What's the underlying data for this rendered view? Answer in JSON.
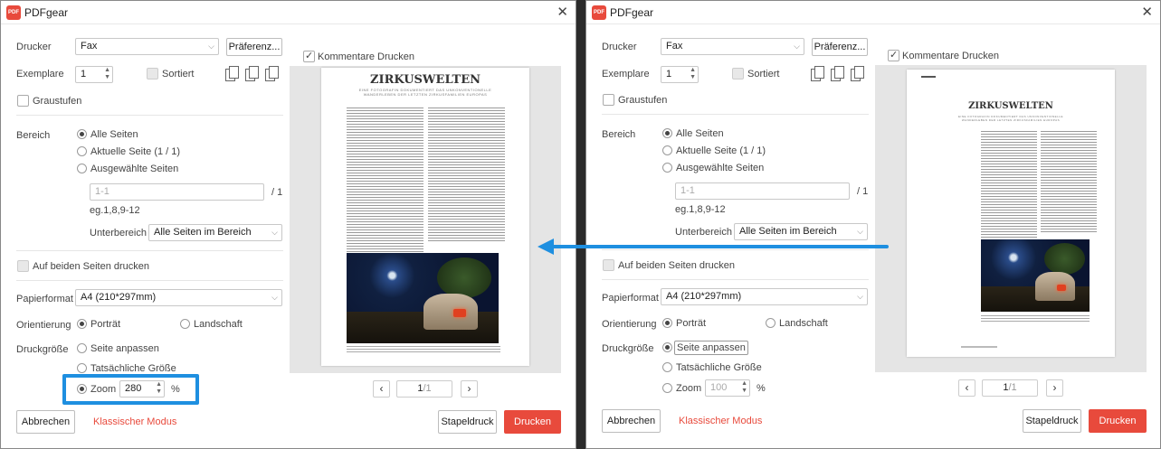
{
  "app": {
    "title": "PDFgear",
    "logo_text": "PDF"
  },
  "colors": {
    "accent": "#e84a3c",
    "highlight": "#1e8fe0",
    "arrow": "#1e8fe0"
  },
  "labels": {
    "printer": "Drucker",
    "preferences": "Präferenz...",
    "copies": "Exemplare",
    "collate": "Sortiert",
    "grayscale": "Graustufen",
    "range": "Bereich",
    "all_pages": "Alle Seiten",
    "current_page": "Aktuelle Seite (1 / 1)",
    "selected_pages": "Ausgewählte Seiten",
    "pages_total": "/ 1",
    "pages_hint": "eg.1,8,9-12",
    "subrange": "Unterbereich",
    "duplex": "Auf beiden Seiten drucken",
    "paper_format": "Papierformat",
    "orientation": "Orientierung",
    "portrait": "Porträt",
    "landscape": "Landschaft",
    "print_size": "Druckgröße",
    "fit_page": "Seite anpassen",
    "actual_size": "Tatsächliche Größe",
    "zoom": "Zoom",
    "percent": "%",
    "print_comments": "Kommentare Drucken",
    "cancel": "Abbrechen",
    "classic_mode": "Klassischer Modus",
    "batch_print": "Stapeldruck",
    "print": "Drucken"
  },
  "left": {
    "printer_value": "Fax",
    "copies_value": "1",
    "pages_input_placeholder": "1-1",
    "subrange_value": "Alle Seiten im Bereich",
    "paper_value": "A4 (210*297mm)",
    "zoom_value": "280",
    "page_current": "1",
    "page_total": "/1",
    "print_size_selected": "zoom"
  },
  "right": {
    "printer_value": "Fax",
    "copies_value": "1",
    "pages_input_placeholder": "1-1",
    "subrange_value": "Alle Seiten im Bereich",
    "paper_value": "A4 (210*297mm)",
    "zoom_value": "100",
    "page_current": "1",
    "page_total": "/1",
    "print_size_selected": "fit_page"
  },
  "preview_doc": {
    "heading": "ZIRKUSWELTEN",
    "subheading_1": "EINE FOTOGRAFIN DOKUMENTIERT DAS UNKONVENTIONELLE",
    "subheading_2": "WANDERLEBEN DER LETZTEN ZIRKUSFAMILIEN EUROPAS"
  }
}
